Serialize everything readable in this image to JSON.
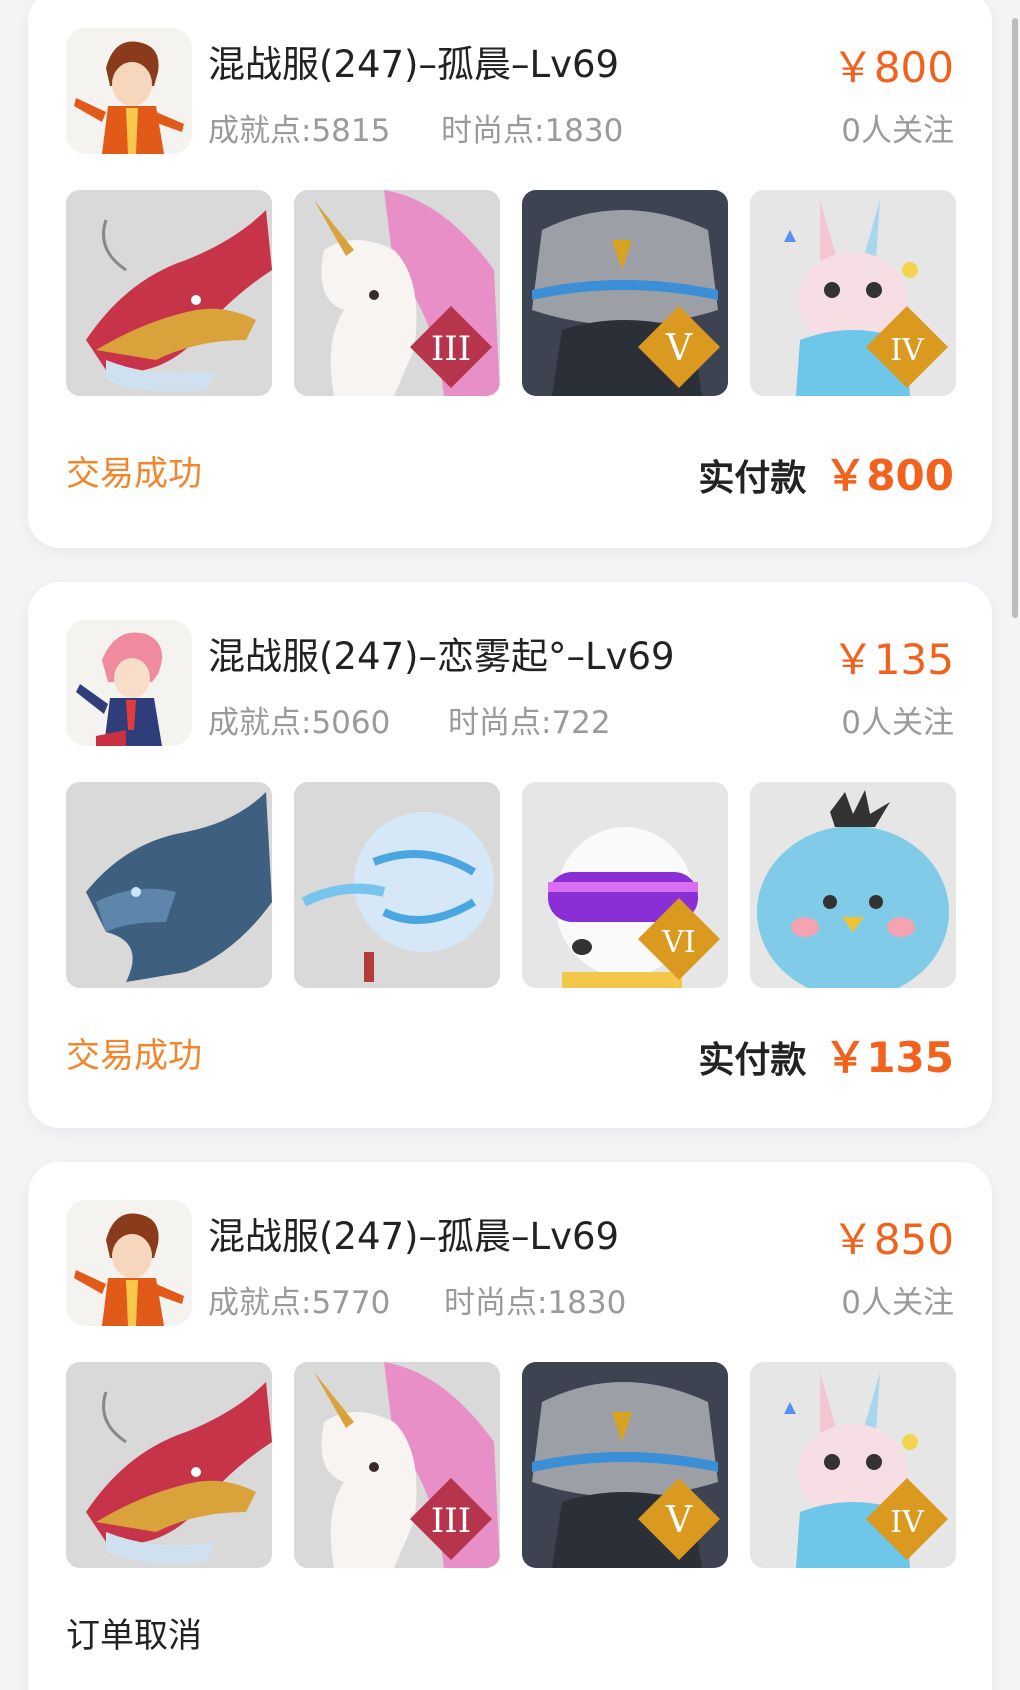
{
  "orders": [
    {
      "title": "混战服(247)–孤晨–Lv69",
      "achievement": "成就点:5815",
      "fashion": "时尚点:1830",
      "price": "￥800",
      "followers": "0人关注",
      "status": "交易成功",
      "paid_label": "实付款",
      "paid_amount": "￥800",
      "items": [
        {
          "icon": "red-dragon-mount-icon"
        },
        {
          "icon": "unicorn-mount-icon",
          "rank": "III"
        },
        {
          "icon": "stone-golem-mount-icon",
          "rank": "V"
        },
        {
          "icon": "pink-bunny-pet-icon",
          "rank": "IV"
        }
      ]
    },
    {
      "title": "混战服(247)–恋雾起°–Lv69",
      "achievement": "成就点:5060",
      "fashion": "时尚点:722",
      "price": "￥135",
      "followers": "0人关注",
      "status": "交易成功",
      "paid_label": "实付款",
      "paid_amount": "￥135",
      "items": [
        {
          "icon": "blue-dragon-mount-icon"
        },
        {
          "icon": "hot-air-balloon-icon"
        },
        {
          "icon": "goggle-dog-pet-icon",
          "rank": "VI"
        },
        {
          "icon": "blue-chick-pet-icon"
        }
      ]
    },
    {
      "title": "混战服(247)–孤晨–Lv69",
      "achievement": "成就点:5770",
      "fashion": "时尚点:1830",
      "price": "￥850",
      "followers": "0人关注",
      "status": "订单取消",
      "items": [
        {
          "icon": "red-dragon-mount-icon"
        },
        {
          "icon": "unicorn-mount-icon",
          "rank": "III"
        },
        {
          "icon": "stone-golem-mount-icon",
          "rank": "V"
        },
        {
          "icon": "pink-bunny-pet-icon",
          "rank": "IV"
        }
      ]
    }
  ],
  "colors": {
    "price": "#f2621c",
    "status_success": "#f2862c",
    "muted_text": "#9a9a9a",
    "rank_badge": "#c0392b"
  }
}
